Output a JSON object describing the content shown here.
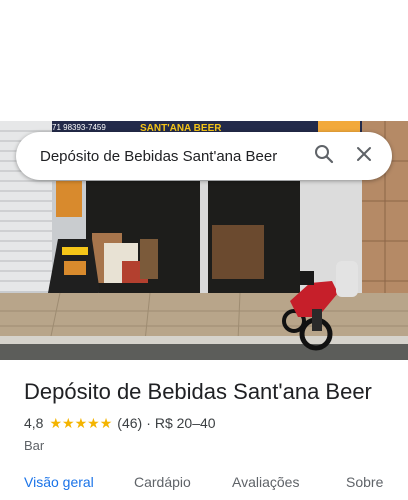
{
  "search": {
    "query": "Depósito de Bebidas Sant'ana Beer"
  },
  "place": {
    "name": "Depósito de Bebidas Sant'ana Beer",
    "rating": "4,8",
    "stars": 5,
    "review_count": "(46)",
    "separator": "·",
    "price_range": "R$ 20–40",
    "category": "Bar"
  },
  "photo": {
    "sign_text": "SANT'ANA BEER",
    "phone_text": "71 98393-7459"
  },
  "tabs": [
    {
      "label": "Visão geral",
      "active": true
    },
    {
      "label": "Cardápio",
      "active": false
    },
    {
      "label": "Avaliações",
      "active": false
    },
    {
      "label": "Sobre",
      "active": false
    }
  ],
  "colors": {
    "accent": "#1a73e8",
    "star": "#f4b400"
  },
  "icons": [
    "search-icon",
    "close-icon",
    "star-icon"
  ]
}
